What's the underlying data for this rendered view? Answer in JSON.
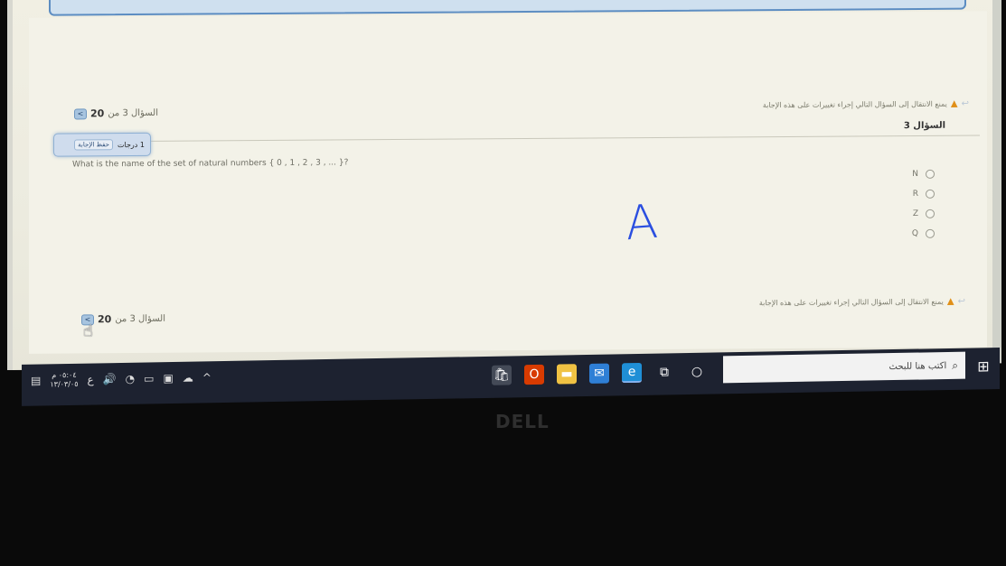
{
  "nav": {
    "top": {
      "label": "السؤال 3 من",
      "count": "20"
    },
    "bottom": {
      "label": "السؤال 3 من",
      "count": "20"
    },
    "arrow": "<"
  },
  "warnings": {
    "top": "يمنع الانتقال إلى السؤال التالي إجراء تغييرات على هذه الإجابة",
    "bottom": "يمنع الانتقال إلى السؤال التالي إجراء تغييرات على هذه الإجابة"
  },
  "question": {
    "title": "السؤال 3",
    "grade": "1 درجات",
    "save_button": "حفظ الإجابة",
    "text": "What is the name of the set of natural numbers { 0 , 1 , 2 , 3 , ... }?",
    "options": [
      "N",
      "R",
      "Z",
      "Q"
    ]
  },
  "annotation": {
    "handwritten": "A"
  },
  "taskbar": {
    "search_placeholder": "اكتب هنا للبحث",
    "clock_time": "٠٥:٠٤ م",
    "clock_date": "١٣/٠٣/٠٥",
    "lang": "ع",
    "icons": [
      "store-icon",
      "office-icon",
      "file-explorer-icon",
      "mail-icon",
      "edge-icon",
      "task-view-icon",
      "cortana-icon"
    ]
  },
  "hardware": {
    "brand": "DELL"
  },
  "colors": {
    "accent": "#5c8dc2",
    "warning": "#e08f17",
    "taskbar": "#1d2230",
    "annotation": "#2b4fe0"
  }
}
